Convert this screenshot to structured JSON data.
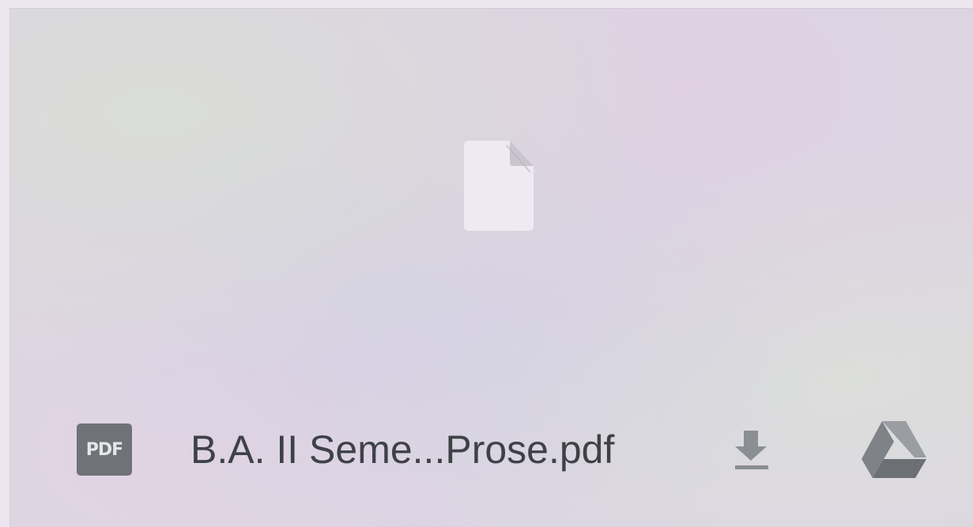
{
  "file_bar": {
    "file_type_badge": "PDF",
    "file_name": "B.A. II Seme...Prose.pdf"
  },
  "icons": {
    "preview": "file-icon",
    "file_type": "pdf-icon",
    "download": "download-icon",
    "drive": "google-drive-icon"
  },
  "colors": {
    "badge": "#6f7378",
    "text": "#3e4247",
    "icon_gray": "#8b8f94"
  }
}
